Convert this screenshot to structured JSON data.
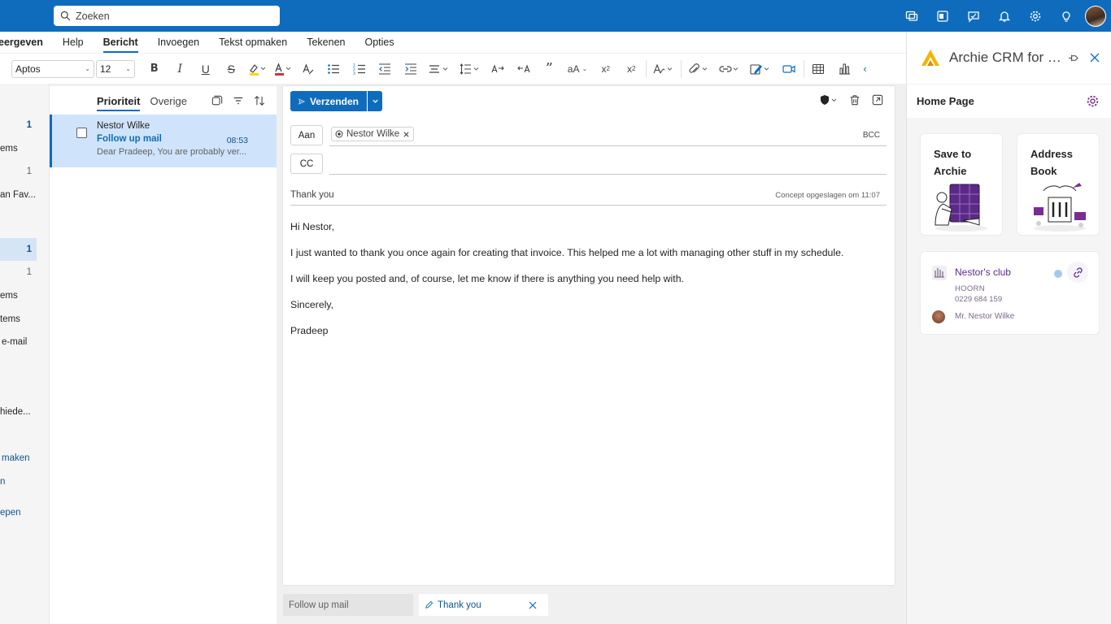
{
  "search": {
    "placeholder": "Zoeken"
  },
  "menu": {
    "tabs": [
      "eergeven",
      "Help",
      "Bericht",
      "Invoegen",
      "Tekst opmaken",
      "Tekenen",
      "Opties"
    ],
    "active": "Bericht"
  },
  "ribbon": {
    "font": "Aptos",
    "size": "12"
  },
  "leftnav": {
    "items": [
      "ems",
      "an Fav...",
      "ems",
      "tems",
      "e-mail",
      "hiede...",
      "maken",
      "n",
      "epen"
    ],
    "counts": [
      "1",
      "1",
      "1",
      "1"
    ]
  },
  "maillist": {
    "tabs": [
      "Prioriteit",
      "Overige"
    ],
    "item": {
      "from": "Nestor Wilke",
      "subject": "Follow up mail",
      "time": "08:53",
      "preview": "Dear Pradeep, You are probably ver..."
    }
  },
  "compose": {
    "send_label": "Verzenden",
    "to_label": "Aan",
    "cc_label": "CC",
    "bcc_label": "BCC",
    "to_recipient": "Nestor Wilke",
    "subject": "Thank you",
    "saved_status": "Concept opgeslagen om 11:07",
    "body": [
      "Hi Nestor,",
      "I just wanted to thank you once again for creating that invoice. This helped me a lot with managing other stuff in my schedule.",
      "I will keep you posted and, of course, let me know if there is anything you need help with.",
      "Sincerely,",
      "Pradeep"
    ]
  },
  "bottom_tabs": [
    "Follow up mail",
    "Thank you"
  ],
  "addin": {
    "title": "Archie CRM for Ou...",
    "home": "Home Page",
    "save_card": "Save to Archie",
    "address_card": "Address Book",
    "club": {
      "name": "Nestor's club",
      "city": "HOORN",
      "phone": "0229 684 159",
      "person": "Mr. Nestor Wilke"
    }
  },
  "colors": {
    "accent": "#0f6cbd",
    "addin_purple": "#5b2a86",
    "selection": "#cfe4fa"
  }
}
